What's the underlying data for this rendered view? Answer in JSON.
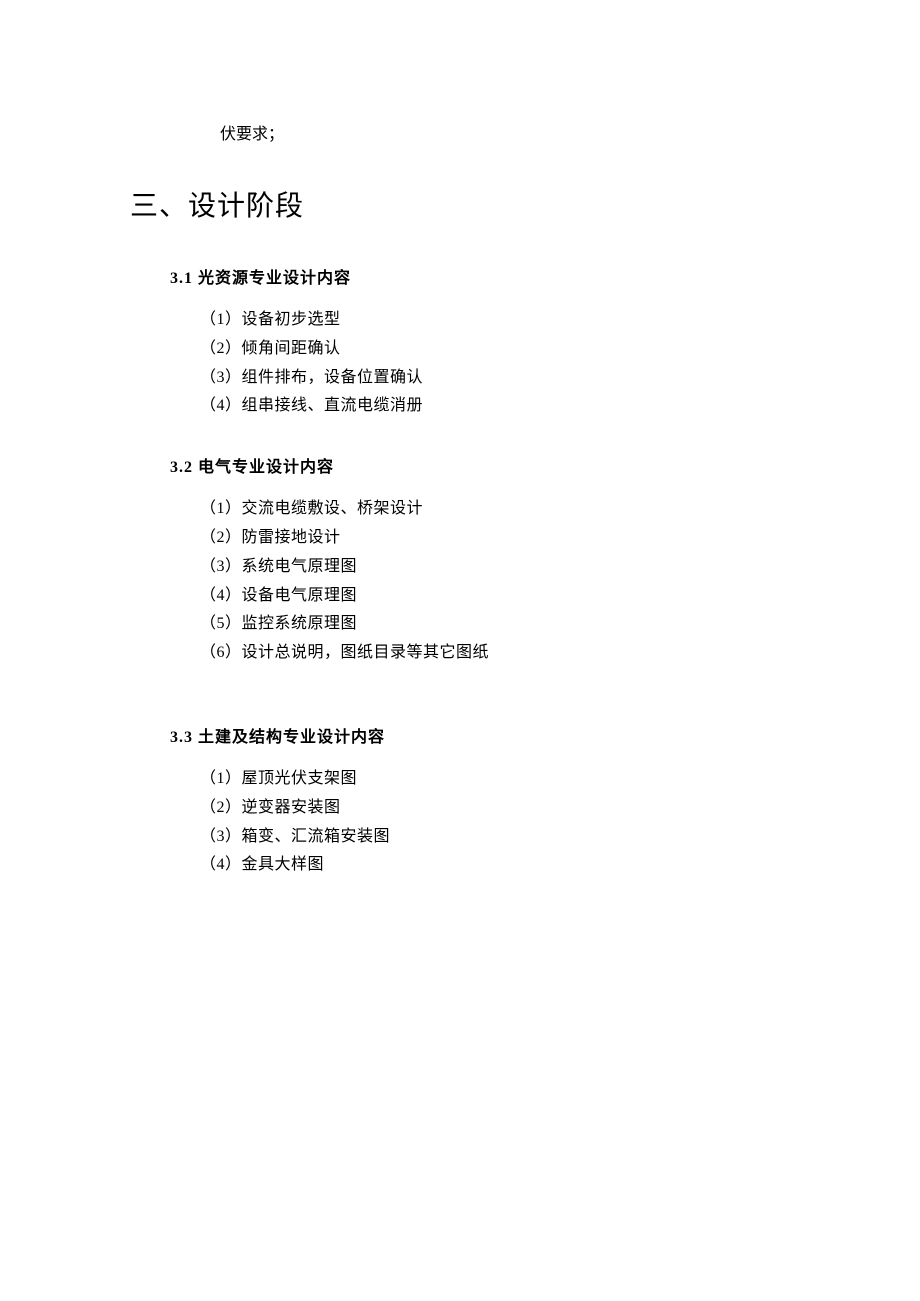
{
  "fragment": "伏要求；",
  "mainHeading": "三、设计阶段",
  "sections": [
    {
      "heading": "3.1 光资源专业设计内容",
      "items": [
        "（1）设备初步选型",
        "（2）倾角间距确认",
        "（3）组件排布，设备位置确认",
        "（4）组串接线、直流电缆消册"
      ]
    },
    {
      "heading": "3.2 电气专业设计内容",
      "items": [
        "（1）交流电缆敷设、桥架设计",
        "（2）防雷接地设计",
        "（3）系统电气原理图",
        "（4）设备电气原理图",
        "（5）监控系统原理图",
        "（6）设计总说明，图纸目录等其它图纸"
      ]
    },
    {
      "heading": "3.3 土建及结构专业设计内容",
      "items": [
        "（1）屋顶光伏支架图",
        "（2）逆变器安装图",
        "（3）箱变、汇流箱安装图",
        "（4）金具大样图"
      ]
    }
  ]
}
